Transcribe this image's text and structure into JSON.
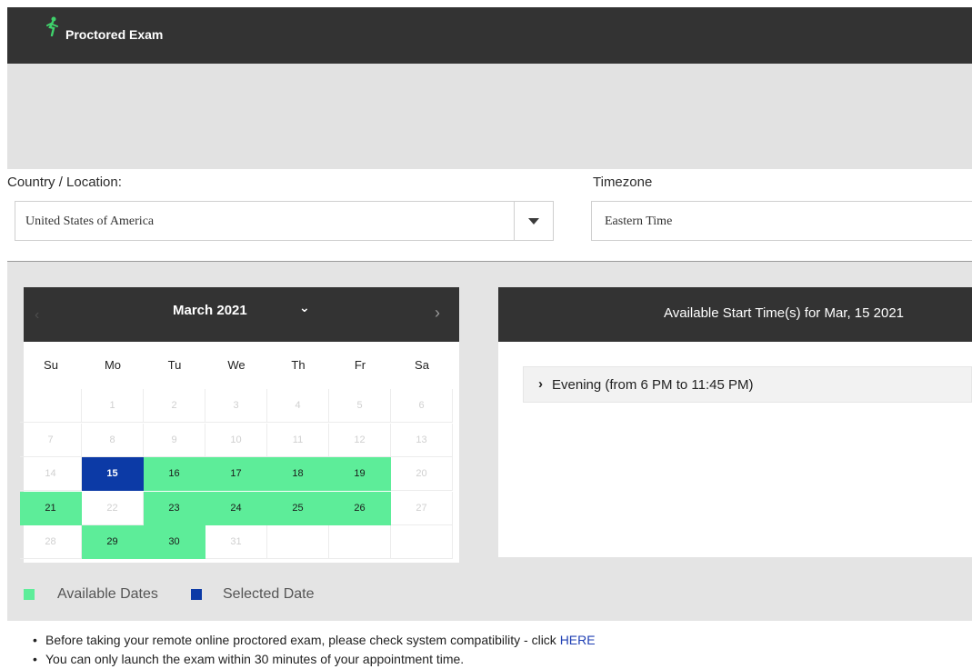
{
  "header": {
    "title": "Proctored Exam",
    "logo_icon": "person-runner-icon",
    "logo_color": "#3fd26b"
  },
  "location": {
    "country_label": "Country / Location:",
    "country_value": "United States of America",
    "timezone_label": "Timezone",
    "timezone_value": "Eastern Time"
  },
  "calendar": {
    "month_label": "March 2021",
    "weekdays": [
      "Su",
      "Mo",
      "Tu",
      "We",
      "Th",
      "Fr",
      "Sa"
    ],
    "weeks": [
      [
        {
          "d": "",
          "s": "empty"
        },
        {
          "d": "1",
          "s": "off"
        },
        {
          "d": "2",
          "s": "off"
        },
        {
          "d": "3",
          "s": "off"
        },
        {
          "d": "4",
          "s": "off"
        },
        {
          "d": "5",
          "s": "off"
        },
        {
          "d": "6",
          "s": "off"
        }
      ],
      [
        {
          "d": "7",
          "s": "off"
        },
        {
          "d": "8",
          "s": "off"
        },
        {
          "d": "9",
          "s": "off"
        },
        {
          "d": "10",
          "s": "off"
        },
        {
          "d": "11",
          "s": "off"
        },
        {
          "d": "12",
          "s": "off"
        },
        {
          "d": "13",
          "s": "off"
        }
      ],
      [
        {
          "d": "14",
          "s": "off"
        },
        {
          "d": "15",
          "s": "sel"
        },
        {
          "d": "16",
          "s": "avail"
        },
        {
          "d": "17",
          "s": "avail"
        },
        {
          "d": "18",
          "s": "avail"
        },
        {
          "d": "19",
          "s": "avail"
        },
        {
          "d": "20",
          "s": "off"
        }
      ],
      [
        {
          "d": "21",
          "s": "avail"
        },
        {
          "d": "22",
          "s": "off"
        },
        {
          "d": "23",
          "s": "avail"
        },
        {
          "d": "24",
          "s": "avail"
        },
        {
          "d": "25",
          "s": "avail"
        },
        {
          "d": "26",
          "s": "avail"
        },
        {
          "d": "27",
          "s": "off"
        }
      ],
      [
        {
          "d": "28",
          "s": "off"
        },
        {
          "d": "29",
          "s": "avail"
        },
        {
          "d": "30",
          "s": "avail"
        },
        {
          "d": "31",
          "s": "off"
        },
        {
          "d": "",
          "s": "empty"
        },
        {
          "d": "",
          "s": "empty"
        },
        {
          "d": "",
          "s": "empty"
        }
      ]
    ],
    "colors": {
      "available": "#5ded99",
      "selected": "#0c3aa6"
    }
  },
  "times": {
    "header": "Available Start Time(s) for Mar, 15 2021",
    "groups": [
      {
        "label": "Evening (from 6 PM to 11:45 PM)"
      }
    ]
  },
  "legend": {
    "available_label": "Available Dates",
    "selected_label": "Selected Date"
  },
  "notes": {
    "items": [
      {
        "text": "Before taking your remote online proctored exam, please check system compatibility - click ",
        "link": "HERE"
      },
      {
        "text": "You can only launch the exam within 30 minutes of your appointment time.",
        "link": ""
      }
    ]
  }
}
